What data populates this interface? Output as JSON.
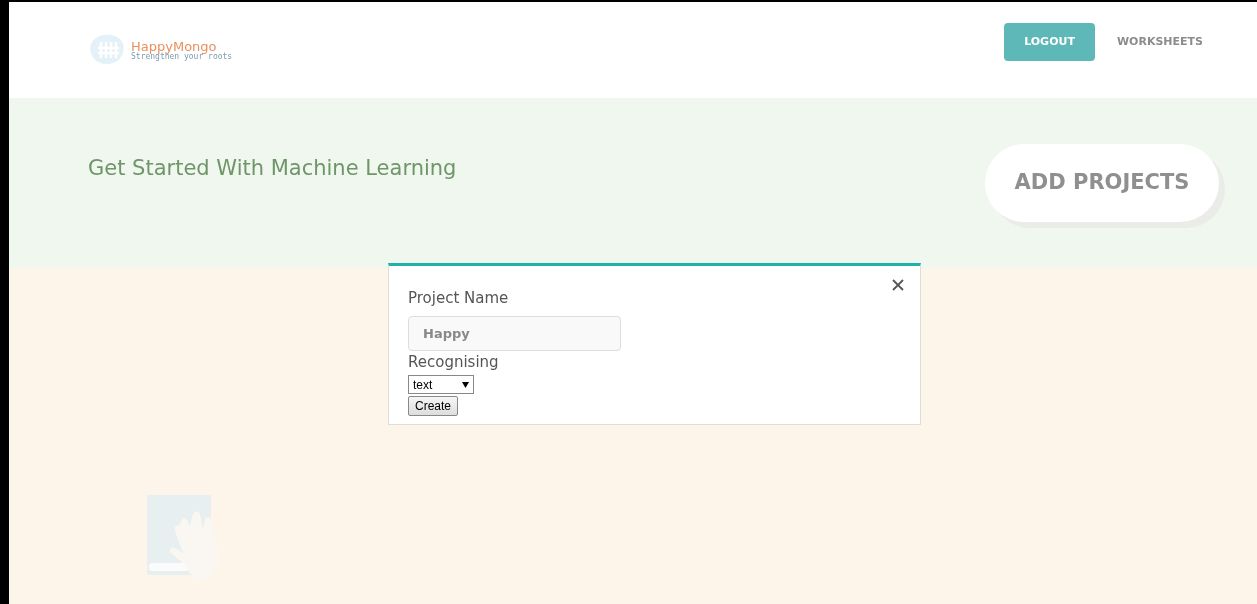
{
  "header": {
    "logo": {
      "name": "HappyMongo",
      "tagline": "Strengthen your roots"
    },
    "nav": [
      {
        "label": "LOGOUT",
        "kind": "filled"
      },
      {
        "label": "WORKSHEETS",
        "kind": "plain"
      }
    ]
  },
  "banner": {
    "title": "Get Started With Machine Learning",
    "action": "ADD PROJECTS"
  },
  "modal": {
    "fields": [
      {
        "kind": "text",
        "label": "Project Name",
        "value": "Happy"
      },
      {
        "kind": "select",
        "label": "Recognising",
        "value": "text"
      }
    ],
    "submit": "Create"
  }
}
